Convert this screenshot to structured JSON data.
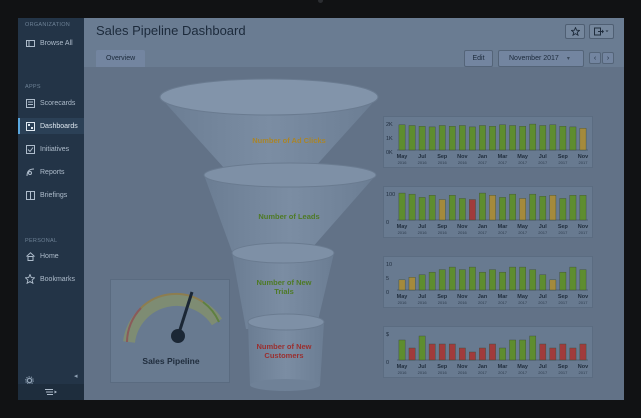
{
  "sidebar": {
    "section_org": "ORGANIZATION",
    "section_apps": "APPS",
    "section_personal": "PERSONAL",
    "items": [
      {
        "label": "Browse All",
        "icon": "browse-icon"
      },
      {
        "label": "Scorecards",
        "icon": "scorecard-icon"
      },
      {
        "label": "Dashboards",
        "icon": "dashboard-icon"
      },
      {
        "label": "Initiatives",
        "icon": "checkbox-icon"
      },
      {
        "label": "Reports",
        "icon": "report-icon"
      },
      {
        "label": "Briefings",
        "icon": "book-icon"
      },
      {
        "label": "Home",
        "icon": "home-icon"
      },
      {
        "label": "Bookmarks",
        "icon": "star-icon"
      }
    ]
  },
  "header": {
    "title": "Sales Pipeline Dashboard",
    "tab": "Overview",
    "edit_label": "Edit",
    "date_label": "November 2017"
  },
  "funnel": {
    "stages": [
      {
        "label": "Number of Ad Clicks",
        "color": "#a9852a"
      },
      {
        "label": "Number of Leads",
        "color": "#4e7a25"
      },
      {
        "label": "Number of New Trials",
        "color": "#4e7a25"
      },
      {
        "label": "Number of New Customers",
        "color": "#9a2f2f"
      }
    ]
  },
  "gauge": {
    "label": "Sales Pipeline",
    "value_fraction": 0.62
  },
  "colors": {
    "green": "#5e8d2f",
    "gold": "#a48a3c",
    "red": "#a13b3b",
    "accent": "#5aa8e0"
  },
  "chart_data": [
    {
      "type": "bar",
      "title": "Number of Ad Clicks",
      "categories": [
        "May 2016",
        "Jun 2016",
        "Jul 2016",
        "Aug 2016",
        "Sep 2016",
        "Oct 2016",
        "Nov 2016",
        "Dec 2016",
        "Jan 2017",
        "Feb 2017",
        "Mar 2017",
        "Apr 2017",
        "May 2017",
        "Jun 2017",
        "Jul 2017",
        "Aug 2017",
        "Sep 2017",
        "Oct 2017",
        "Nov 2017"
      ],
      "tick_labels": [
        {
          "m": "May",
          "y": "2016"
        },
        {
          "m": "Jul",
          "y": "2016"
        },
        {
          "m": "Sep",
          "y": "2016"
        },
        {
          "m": "Nov",
          "y": "2016"
        },
        {
          "m": "Jan",
          "y": "2017"
        },
        {
          "m": "Mar",
          "y": "2017"
        },
        {
          "m": "May",
          "y": "2017"
        },
        {
          "m": "Jul",
          "y": "2017"
        },
        {
          "m": "Sep",
          "y": "2017"
        },
        {
          "m": "Nov",
          "y": "2017"
        }
      ],
      "yticks": [
        "2K",
        "1K",
        "0K"
      ],
      "ylim": [
        0,
        2000
      ],
      "values": [
        1800,
        1750,
        1700,
        1650,
        1750,
        1700,
        1750,
        1650,
        1750,
        1700,
        1800,
        1750,
        1700,
        1850,
        1750,
        1800,
        1700,
        1650,
        1550
      ],
      "status": [
        "g",
        "g",
        "g",
        "g",
        "g",
        "g",
        "g",
        "g",
        "g",
        "g",
        "g",
        "g",
        "g",
        "g",
        "g",
        "g",
        "g",
        "g",
        "y"
      ]
    },
    {
      "type": "bar",
      "title": "Number of Leads",
      "categories": [
        "May 2016",
        "Jun 2016",
        "Jul 2016",
        "Aug 2016",
        "Sep 2016",
        "Oct 2016",
        "Nov 2016",
        "Dec 2016",
        "Jan 2017",
        "Feb 2017",
        "Mar 2017",
        "Apr 2017",
        "May 2017",
        "Jun 2017",
        "Jul 2017",
        "Aug 2017",
        "Sep 2017",
        "Oct 2017",
        "Nov 2017"
      ],
      "tick_labels": [
        {
          "m": "May",
          "y": "2016"
        },
        {
          "m": "Jul",
          "y": "2016"
        },
        {
          "m": "Sep",
          "y": "2016"
        },
        {
          "m": "Nov",
          "y": "2016"
        },
        {
          "m": "Jan",
          "y": "2017"
        },
        {
          "m": "Mar",
          "y": "2017"
        },
        {
          "m": "May",
          "y": "2017"
        },
        {
          "m": "Jul",
          "y": "2017"
        },
        {
          "m": "Sep",
          "y": "2017"
        },
        {
          "m": "Nov",
          "y": "2017"
        }
      ],
      "yticks": [
        "100",
        "0"
      ],
      "ylim": [
        0,
        130
      ],
      "values": [
        125,
        120,
        105,
        115,
        95,
        115,
        100,
        95,
        125,
        115,
        105,
        120,
        100,
        120,
        110,
        115,
        100,
        115,
        115
      ],
      "status": [
        "g",
        "g",
        "g",
        "g",
        "y",
        "g",
        "g",
        "r",
        "g",
        "y",
        "g",
        "g",
        "y",
        "g",
        "g",
        "y",
        "g",
        "g",
        "g"
      ]
    },
    {
      "type": "bar",
      "title": "Number of New Trials",
      "categories": [
        "May 2016",
        "Jun 2016",
        "Jul 2016",
        "Aug 2016",
        "Sep 2016",
        "Oct 2016",
        "Nov 2016",
        "Dec 2016",
        "Jan 2017",
        "Feb 2017",
        "Mar 2017",
        "Apr 2017",
        "May 2017",
        "Jun 2017",
        "Jul 2017",
        "Aug 2017",
        "Sep 2017",
        "Oct 2017",
        "Nov 2017"
      ],
      "tick_labels": [
        {
          "m": "May",
          "y": "2016"
        },
        {
          "m": "Jul",
          "y": "2016"
        },
        {
          "m": "Sep",
          "y": "2016"
        },
        {
          "m": "Nov",
          "y": "2016"
        },
        {
          "m": "Jan",
          "y": "2017"
        },
        {
          "m": "Mar",
          "y": "2017"
        },
        {
          "m": "May",
          "y": "2017"
        },
        {
          "m": "Jul",
          "y": "2017"
        },
        {
          "m": "Sep",
          "y": "2017"
        },
        {
          "m": "Nov",
          "y": "2017"
        }
      ],
      "yticks": [
        "10",
        "5",
        "0"
      ],
      "ylim": [
        0,
        11
      ],
      "values": [
        4,
        5,
        6,
        7,
        8,
        9,
        8,
        9,
        7,
        8,
        7,
        9,
        9,
        8,
        6,
        4,
        7,
        9,
        8
      ],
      "status": [
        "y",
        "y",
        "g",
        "g",
        "g",
        "g",
        "g",
        "g",
        "g",
        "g",
        "g",
        "g",
        "g",
        "g",
        "g",
        "y",
        "g",
        "g",
        "g"
      ]
    },
    {
      "type": "bar",
      "title": "Number of New Customers",
      "categories": [
        "May 2016",
        "Jun 2016",
        "Jul 2016",
        "Aug 2016",
        "Sep 2016",
        "Oct 2016",
        "Nov 2016",
        "Dec 2016",
        "Jan 2017",
        "Feb 2017",
        "Mar 2017",
        "Apr 2017",
        "May 2017",
        "Jun 2017",
        "Jul 2017",
        "Aug 2017",
        "Sep 2017",
        "Oct 2017",
        "Nov 2017"
      ],
      "tick_labels": [
        {
          "m": "May",
          "y": "2016"
        },
        {
          "m": "Jul",
          "y": "2016"
        },
        {
          "m": "Sep",
          "y": "2016"
        },
        {
          "m": "Nov",
          "y": "2016"
        },
        {
          "m": "Jan",
          "y": "2017"
        },
        {
          "m": "Mar",
          "y": "2017"
        },
        {
          "m": "May",
          "y": "2017"
        },
        {
          "m": "Jul",
          "y": "2017"
        },
        {
          "m": "Sep",
          "y": "2017"
        },
        {
          "m": "Nov",
          "y": "2017"
        }
      ],
      "yticks": [
        "$",
        "0"
      ],
      "ylim": [
        0,
        7
      ],
      "values": [
        5,
        3,
        6,
        4,
        4,
        4,
        3,
        2,
        3,
        4,
        3,
        5,
        5,
        6,
        4,
        3,
        4,
        3,
        4
      ],
      "status": [
        "g",
        "r",
        "g",
        "r",
        "r",
        "r",
        "r",
        "r",
        "r",
        "r",
        "g",
        "g",
        "g",
        "g",
        "r",
        "r",
        "r",
        "r",
        "r"
      ]
    }
  ]
}
